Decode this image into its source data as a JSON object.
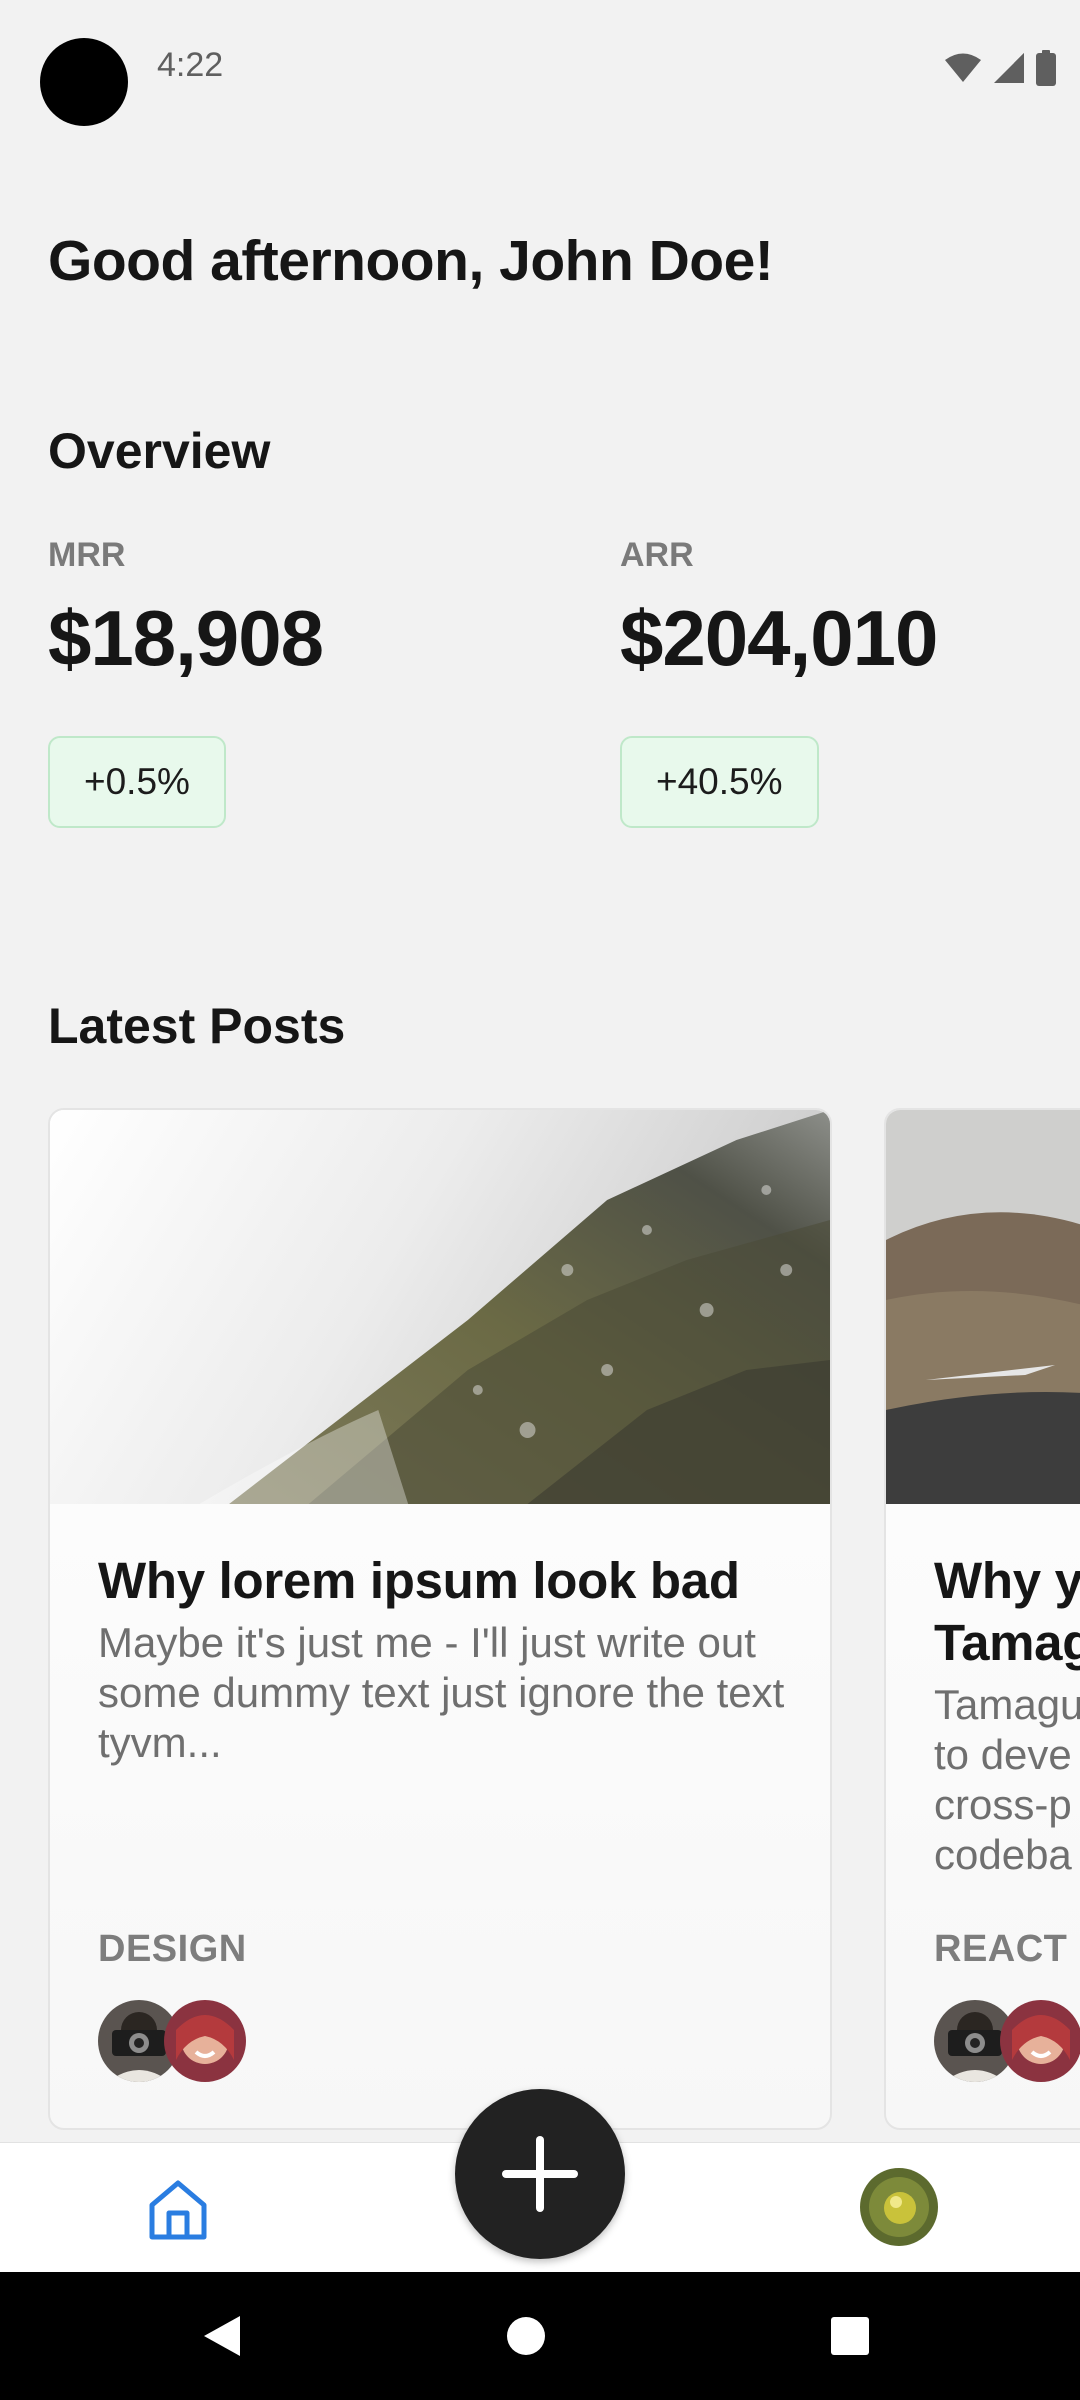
{
  "status_bar": {
    "time": "4:22",
    "icons": [
      "wifi-icon",
      "signal-icon",
      "battery-icon"
    ]
  },
  "greeting": "Good afternoon, John Doe!",
  "overview": {
    "title": "Overview",
    "metrics": [
      {
        "label": "MRR",
        "value": "$18,908",
        "change": "+0.5%"
      },
      {
        "label": "ARR",
        "value": "$204,010",
        "change": "+40.5%"
      }
    ]
  },
  "latest_posts": {
    "title": "Latest Posts",
    "posts": [
      {
        "title": "Why lorem ipsum look bad",
        "excerpt": "Maybe it's just me - I'll just write out some dummy text just ignore the text tyvm...",
        "category": "DESIGN",
        "image": "foggy-forest-hillside-image"
      },
      {
        "title": "Why yo\nTamag",
        "excerpt": "Tamagu\nto deve\ncross-p\ncodeba",
        "category": "REACT",
        "image": "mountain-road-image"
      }
    ]
  },
  "bottom_nav": {
    "items": [
      "home-icon",
      "add-icon",
      "profile-avatar"
    ],
    "active": "home-icon"
  },
  "colors": {
    "background": "#f2f2f2",
    "badge_bg": "#e8f9ec",
    "badge_border": "#bfe8c9",
    "nav_active": "#2a7de1",
    "fab": "#222222"
  }
}
